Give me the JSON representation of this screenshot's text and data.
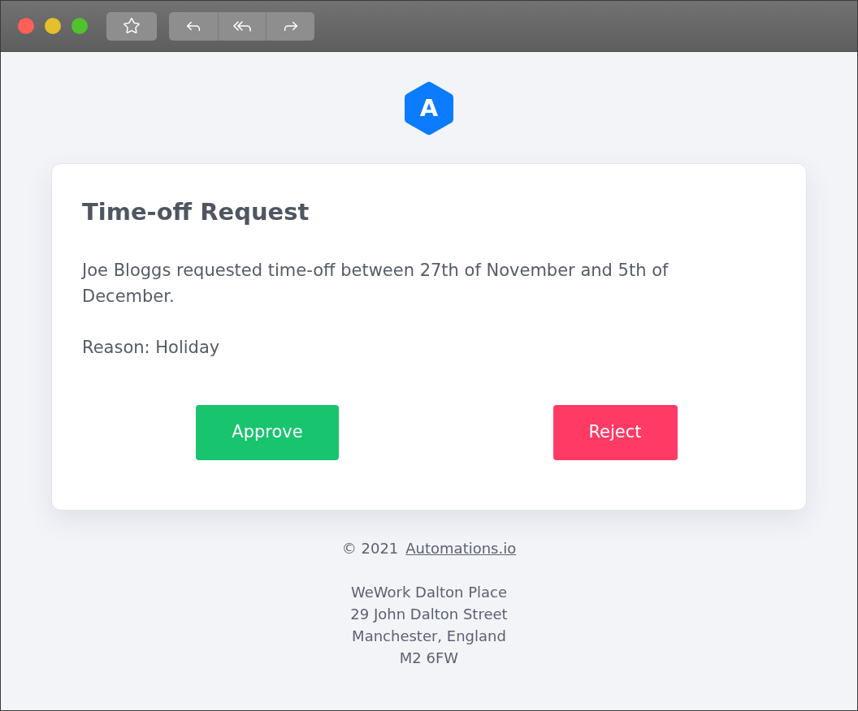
{
  "logo": {
    "letter": "A"
  },
  "card": {
    "title": "Time-off Request",
    "message": "Joe Bloggs requested time-off between 27th of November and 5th of December.",
    "reason": "Reason: Holiday",
    "actions": [
      {
        "label": "Approve",
        "kind": "approve"
      },
      {
        "label": "Reject",
        "kind": "reject"
      }
    ]
  },
  "footer": {
    "copyright": "© 2021",
    "link": "Automations.io",
    "address": [
      "WeWork Dalton Place",
      "29 John Dalton Street",
      "Manchester, England",
      "M2 6FW"
    ]
  }
}
